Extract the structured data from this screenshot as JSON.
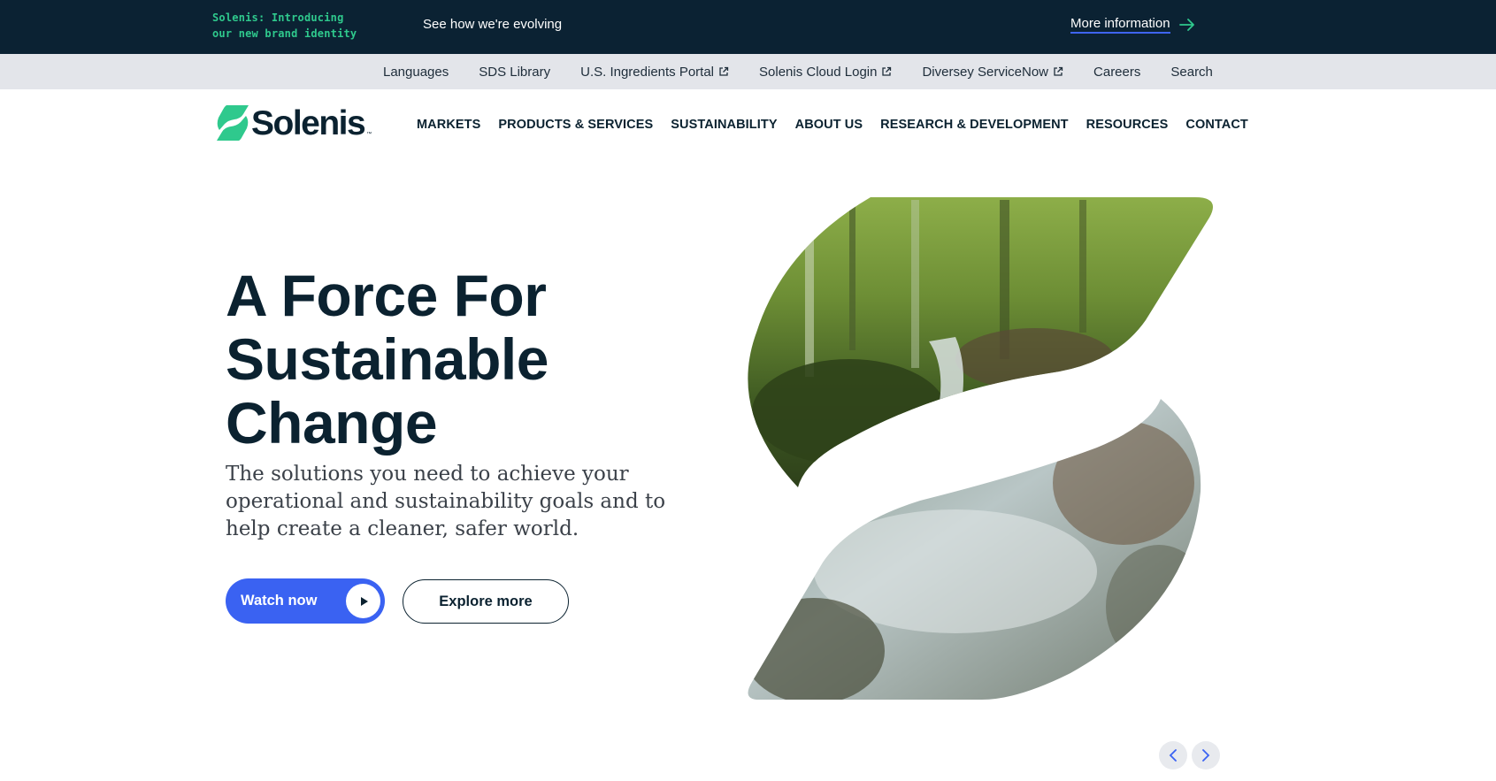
{
  "announcement": {
    "intro": "Solenis: Introducing our new brand identity",
    "evolving": "See how we're evolving",
    "more_link": "More information"
  },
  "utility_links": [
    {
      "label": "Languages",
      "external": false
    },
    {
      "label": "SDS Library",
      "external": false
    },
    {
      "label": "U.S. Ingredients Portal",
      "external": true
    },
    {
      "label": "Solenis Cloud Login",
      "external": true
    },
    {
      "label": "Diversey ServiceNow",
      "external": true
    },
    {
      "label": "Careers",
      "external": false
    },
    {
      "label": "Search",
      "external": false
    }
  ],
  "logo": {
    "text": "Solenis",
    "tm": "™"
  },
  "nav": [
    "MARKETS",
    "PRODUCTS & SERVICES",
    "SUSTAINABILITY",
    "ABOUT US",
    "RESEARCH & DEVELOPMENT",
    "RESOURCES",
    "CONTACT"
  ],
  "hero": {
    "title_lines": [
      "A Force For",
      "Sustainable",
      "Change"
    ],
    "subtitle": "The solutions you need to achieve your operational and sustainability goals and to help create a cleaner, safer world.",
    "watch_label": "Watch now",
    "explore_label": "Explore more"
  },
  "icons": {
    "logo_mark": "solenis-s-mark-icon",
    "more_arrow": "arrow-right-icon",
    "external": "external-link-icon",
    "play": "play-icon",
    "prev": "chevron-left-icon",
    "next": "chevron-right-icon"
  },
  "colors": {
    "navy": "#0b2233",
    "brand_green": "#2fc98d",
    "accent_blue": "#3a62f2",
    "utility_bg": "#e3e5ea"
  }
}
